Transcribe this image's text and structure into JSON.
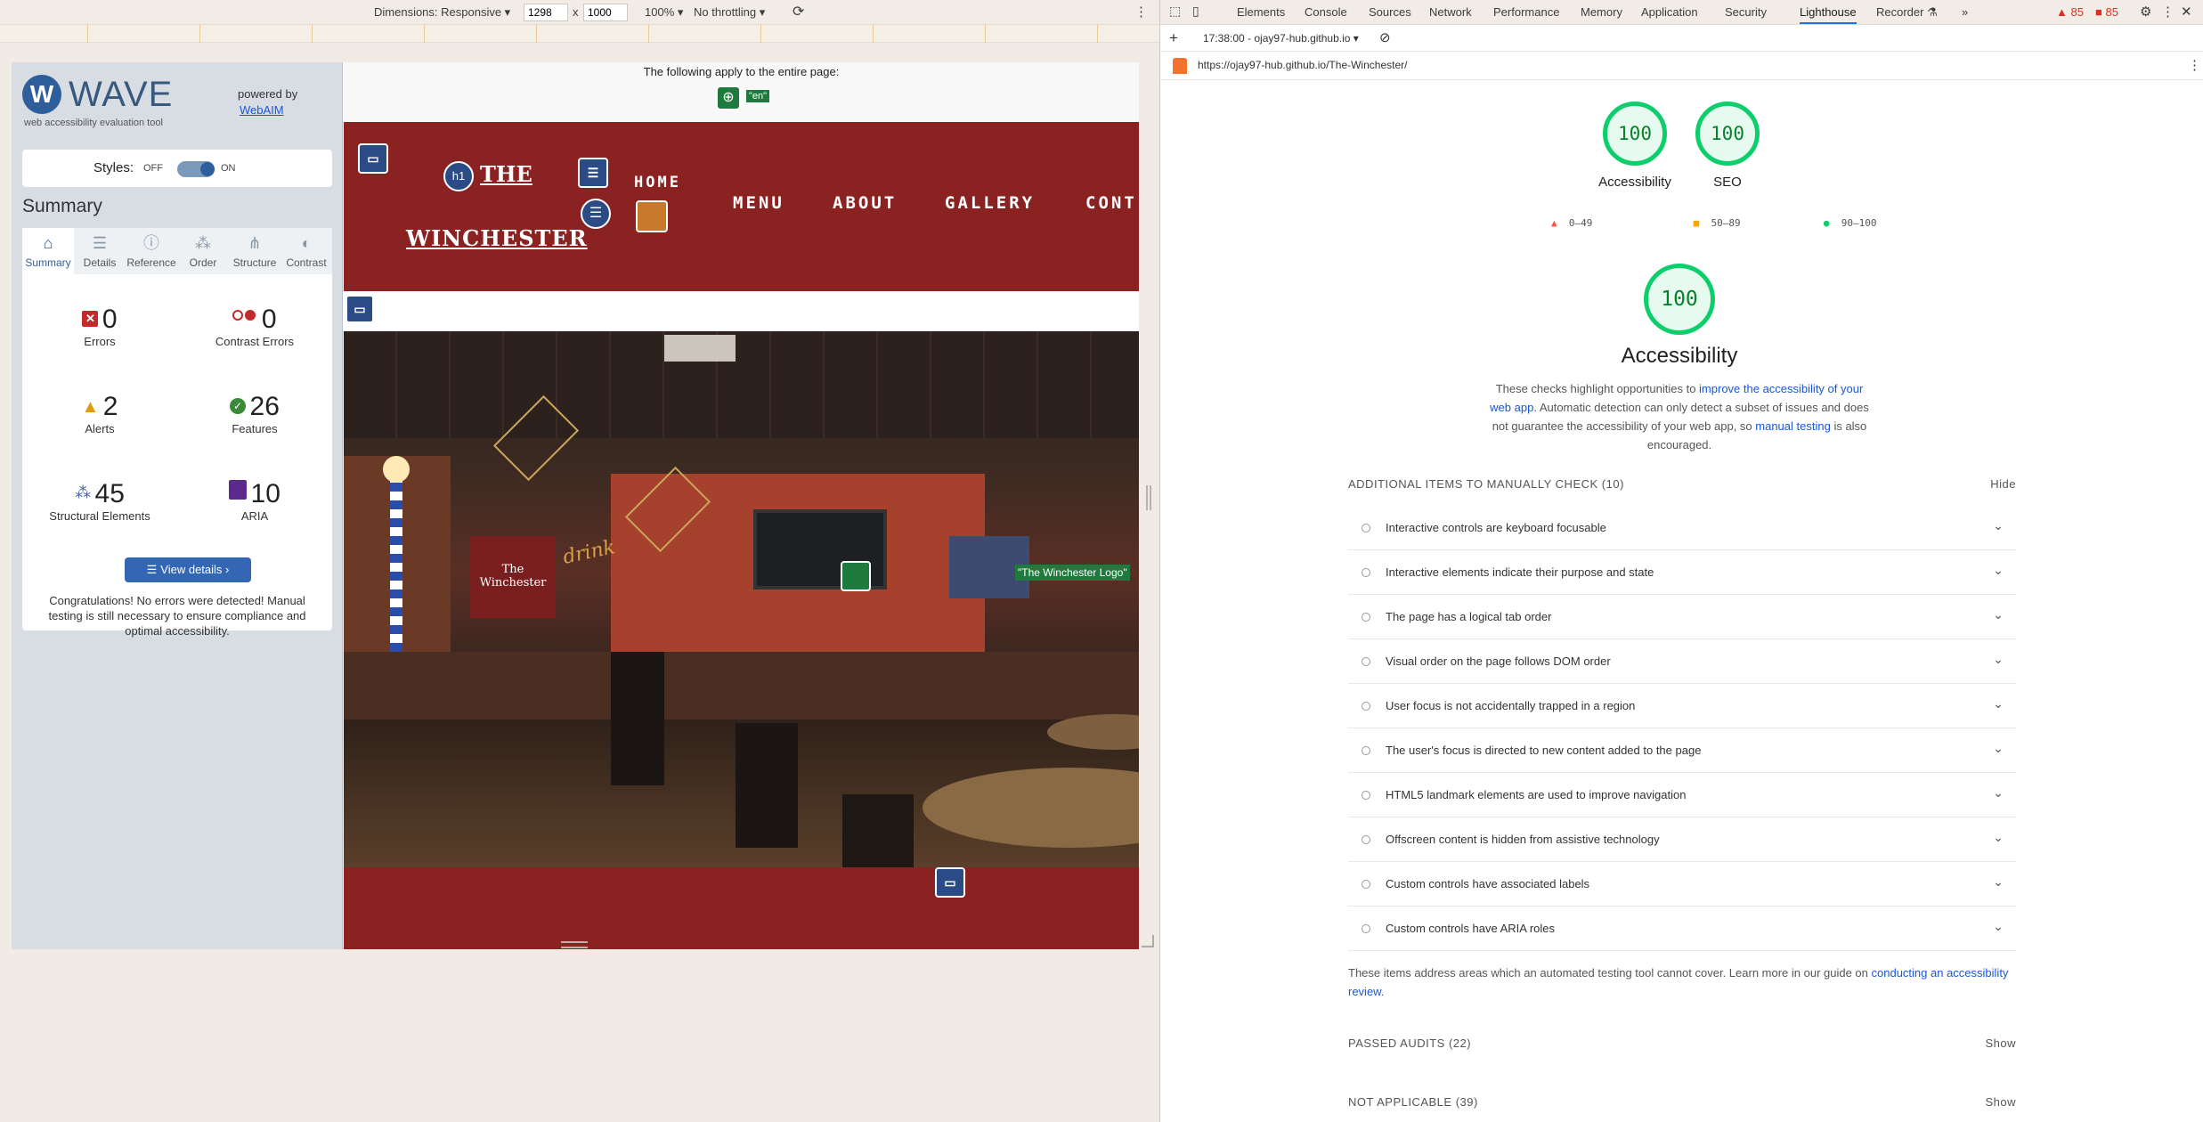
{
  "device_toolbar": {
    "dimensions_label": "Dimensions: Responsive ▾",
    "width": "1298",
    "x": "x",
    "height": "1000",
    "zoom": "100% ▾",
    "throttle": "No throttling ▾"
  },
  "wave": {
    "logo_letter": "W",
    "logo_text": "WAVE",
    "tagline": "web accessibility evaluation tool",
    "powered_by": "powered by",
    "powered_link": "WebAIM",
    "styles_label": "Styles:",
    "styles_off": "OFF",
    "styles_on": "ON",
    "summary_title": "Summary",
    "tabs": [
      "Summary",
      "Details",
      "Reference",
      "Order",
      "Structure",
      "Contrast"
    ],
    "stats": {
      "errors": {
        "num": "0",
        "label": "Errors"
      },
      "contrast": {
        "num": "0",
        "label": "Contrast Errors"
      },
      "alerts": {
        "num": "2",
        "label": "Alerts"
      },
      "features": {
        "num": "26",
        "label": "Features"
      },
      "structural": {
        "num": "45",
        "label": "Structural Elements"
      },
      "aria": {
        "num": "10",
        "label": "ARIA"
      }
    },
    "view_details": "View details ›",
    "congrats": "Congratulations! No errors were detected! Manual testing is still necessary to ensure compliance and optimal accessibility."
  },
  "site": {
    "entire_page_note": "The following apply to the entire page:",
    "lang_badge": "\"en\"",
    "h1_badge": "h1",
    "brand_line1": "THE",
    "brand_line2": "WINCHESTER",
    "nav": [
      "HOME",
      "MENU",
      "ABOUT",
      "GALLERY",
      "CONT"
    ],
    "hero_sign_line1": "The",
    "hero_sign_line2": "Winchester",
    "hero_neon": "drink",
    "alt_badge": "\"The Winchester Logo\""
  },
  "devtools": {
    "tabs": [
      "Elements",
      "Console",
      "Sources",
      "Network",
      "Performance",
      "Memory",
      "Application",
      "Security",
      "Lighthouse",
      "Recorder ⚗",
      "»"
    ],
    "active_tab": "Lighthouse",
    "warn_count": "85",
    "err_count": "85",
    "report_time": "17:38:00 - ojay97-hub.github.io ▾",
    "url": "https://ojay97-hub.github.io/The-Winchester/",
    "gauges": [
      {
        "score": "100",
        "label": "Accessibility"
      },
      {
        "score": "100",
        "label": "SEO"
      }
    ],
    "legend": [
      {
        "range": "0–49",
        "color": "#ff4e42"
      },
      {
        "range": "50–89",
        "color": "#ffa400"
      },
      {
        "range": "90–100",
        "color": "#0cce6b"
      }
    ],
    "main_score": "100",
    "main_title": "Accessibility",
    "desc_a": "These checks highlight opportunities to ",
    "desc_link1": "improve the accessibility of your web app",
    "desc_b": ". Automatic detection can only detect a subset of issues and does not guarantee the accessibility of your web app, so ",
    "desc_link2": "manual testing",
    "desc_c": " is also encouraged.",
    "manual_header": "ADDITIONAL ITEMS TO MANUALLY CHECK",
    "manual_count": "(10)",
    "manual_toggle": "Hide",
    "manual_items": [
      "Interactive controls are keyboard focusable",
      "Interactive elements indicate their purpose and state",
      "The page has a logical tab order",
      "Visual order on the page follows DOM order",
      "User focus is not accidentally trapped in a region",
      "The user's focus is directed to new content added to the page",
      "HTML5 landmark elements are used to improve navigation",
      "Offscreen content is hidden from assistive technology",
      "Custom controls have associated labels",
      "Custom controls have ARIA roles"
    ],
    "footnote_a": "These items address areas which an automated testing tool cannot cover. Learn more in our guide on ",
    "footnote_link": "conducting an accessibility review",
    "footnote_b": ".",
    "passed_header": "PASSED AUDITS",
    "passed_count": "(22)",
    "passed_toggle": "Show",
    "na_header": "NOT APPLICABLE",
    "na_count": "(39)",
    "na_toggle": "Show"
  }
}
